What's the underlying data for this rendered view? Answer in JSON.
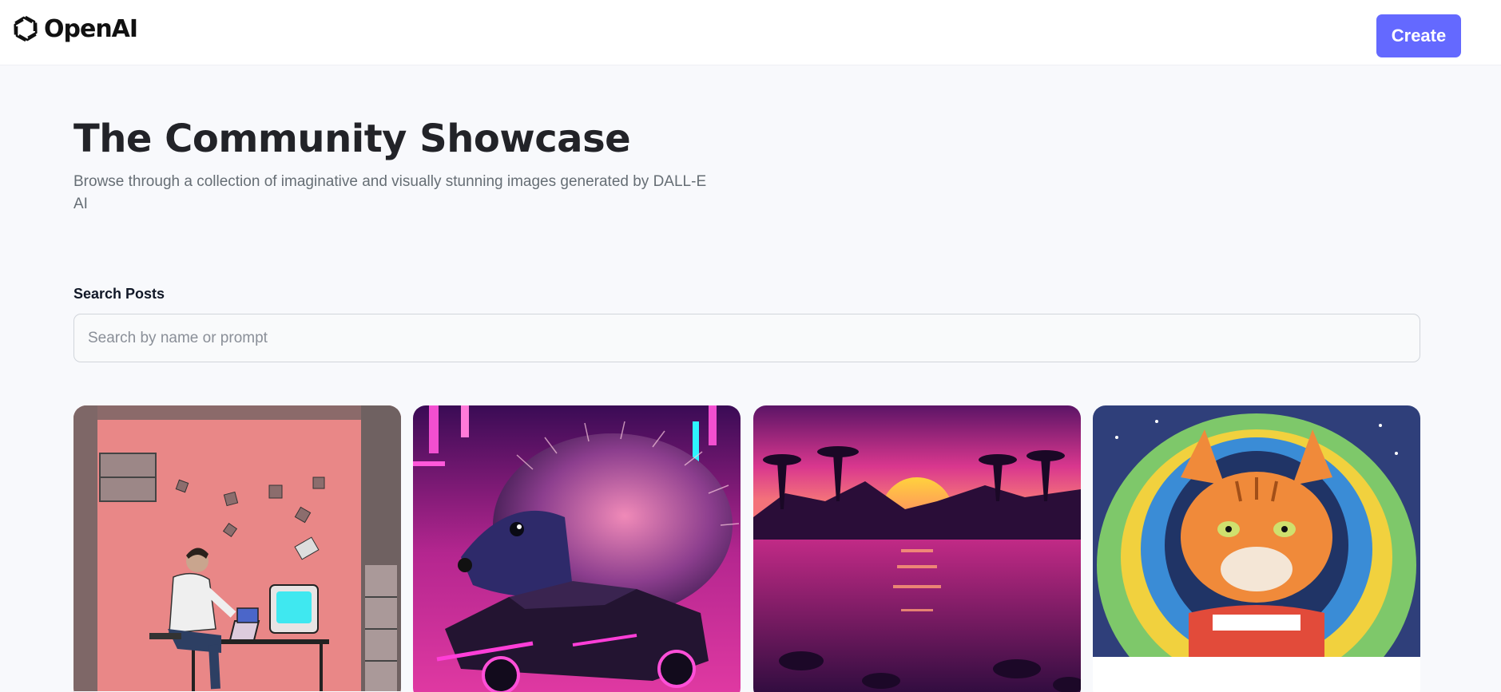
{
  "header": {
    "logo_text": "OpenAI",
    "create_label": "Create"
  },
  "hero": {
    "title": "The Community Showcase",
    "subtitle": "Browse through a collection of imaginative and visually stunning images generated by DALL-E AI"
  },
  "search": {
    "label": "Search Posts",
    "placeholder": "Search by name or prompt",
    "value": ""
  },
  "gallery": {
    "cards": [
      {
        "image": "programmer-at-retro-computer-illustration"
      },
      {
        "image": "neon-hedgehog-on-synthwave-car"
      },
      {
        "image": "synthwave-sunset-over-palm-lake"
      },
      {
        "image": "crayon-cat-astronaut"
      }
    ]
  },
  "colors": {
    "accent": "#6469ff",
    "page_background": "#f8f9fc",
    "title_text": "#222328",
    "subtitle_text": "#666e75"
  }
}
